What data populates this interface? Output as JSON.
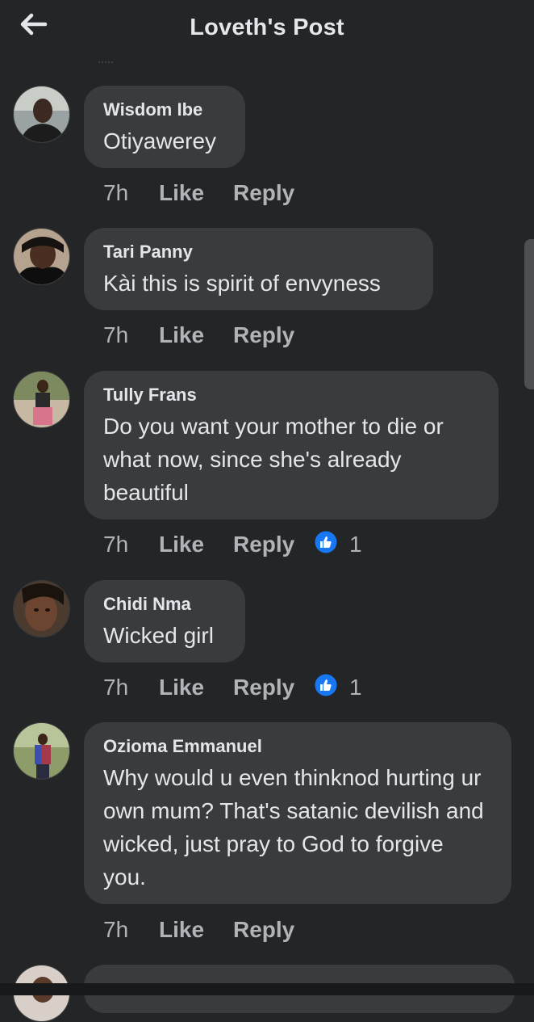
{
  "header": {
    "title": "Loveth's Post",
    "back_icon": "arrow-left-icon"
  },
  "comments": [
    {
      "author": "Wisdom Ibe",
      "text": "Otiyawerey",
      "time": "7h",
      "like": "Like",
      "reply": "Reply"
    },
    {
      "author": "Tari Panny",
      "text": "Kài this is spirit of envyness",
      "time": "7h",
      "like": "Like",
      "reply": "Reply"
    },
    {
      "author": "Tully Frans",
      "text": "Do you want your mother to die or what now, since she's already beautiful",
      "time": "7h",
      "like": "Like",
      "reply": "Reply",
      "reactions": "1",
      "reaction_icon": "thumbs-up-icon"
    },
    {
      "author": "Chidi Nma",
      "text": "Wicked girl",
      "time": "7h",
      "like": "Like",
      "reply": "Reply",
      "reactions": "1",
      "reaction_icon": "thumbs-up-icon"
    },
    {
      "author": "Ozioma Emmanuel",
      "text": "Why would u even thinknod hurting ur own mum? That's satanic devilish and wicked, just pray to God to forgive you.",
      "time": "7h",
      "like": "Like",
      "reply": "Reply"
    }
  ],
  "colors": {
    "background": "#242526",
    "bubble": "#3a3b3c",
    "meta_text": "#b0b3b8",
    "like_blue": "#1877f2"
  }
}
